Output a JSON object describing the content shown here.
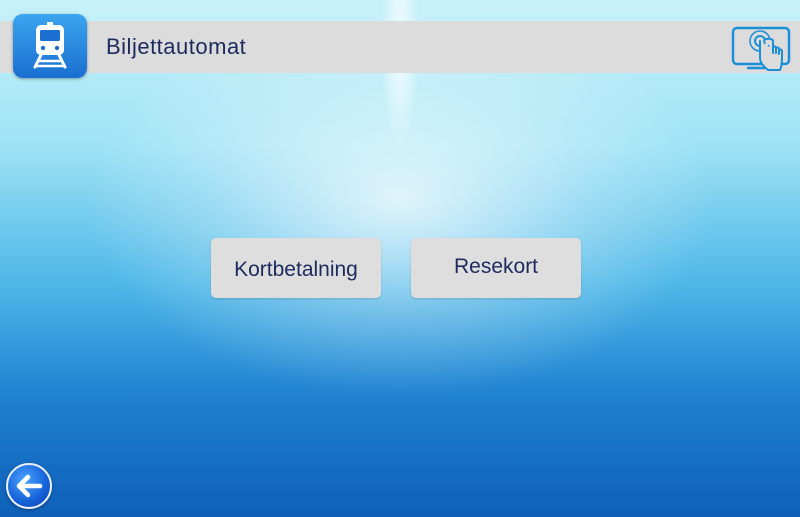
{
  "header": {
    "title": "Biljettautomat",
    "app_icon": "train-icon",
    "touch_icon": "touch-screen-icon"
  },
  "main": {
    "buttons": [
      {
        "label": "Kortbetalning"
      },
      {
        "label": "Resekort"
      }
    ]
  },
  "footer": {
    "back_icon": "back-arrow-icon"
  },
  "colors": {
    "header_bar": "#dcdcdc",
    "text": "#1d2a5e",
    "button": "#dedede",
    "accent_blue": "#1a6fd0"
  }
}
